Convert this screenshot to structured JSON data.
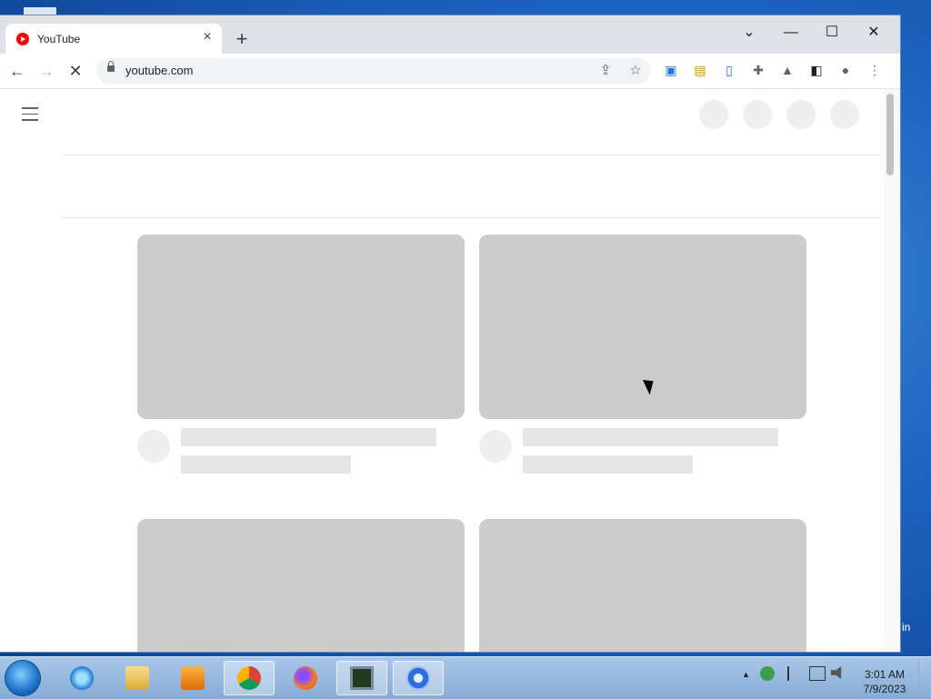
{
  "browser": {
    "tab_title": "YouTube",
    "tab_close": "×",
    "new_tab": "+",
    "url": "youtube.com",
    "window_controls": {
      "list": "⌄",
      "minimize": "—",
      "maximize": "☐",
      "close": "✕"
    },
    "nav": {
      "back": "←",
      "forward": "→",
      "stop": "✕"
    },
    "omnibox_icons": {
      "share": "⇪",
      "bookmark": "☆"
    },
    "extensions": [
      {
        "name": "screen-recorder-icon",
        "glyph": "▣",
        "color": "#1a73e8"
      },
      {
        "name": "reader-icon",
        "glyph": "▤",
        "color": "#c99700"
      },
      {
        "name": "clipboard-icon",
        "glyph": "▯",
        "color": "#1a73e8"
      },
      {
        "name": "puzzle-icon",
        "glyph": "✚",
        "color": "#5f6368"
      },
      {
        "name": "labs-flask-icon",
        "glyph": "▲",
        "color": "#5f6368"
      },
      {
        "name": "side-panel-icon",
        "glyph": "◧",
        "color": "#202124"
      },
      {
        "name": "profile-icon",
        "glyph": "●",
        "color": "#5f6368"
      },
      {
        "name": "menu-kebab-icon",
        "glyph": "⋮",
        "color": "#5f6368"
      }
    ]
  },
  "desktop": {
    "partial_label": "in"
  },
  "taskbar": {
    "time": "3:01 AM",
    "date": "7/9/2023",
    "tray_up": "▲"
  }
}
